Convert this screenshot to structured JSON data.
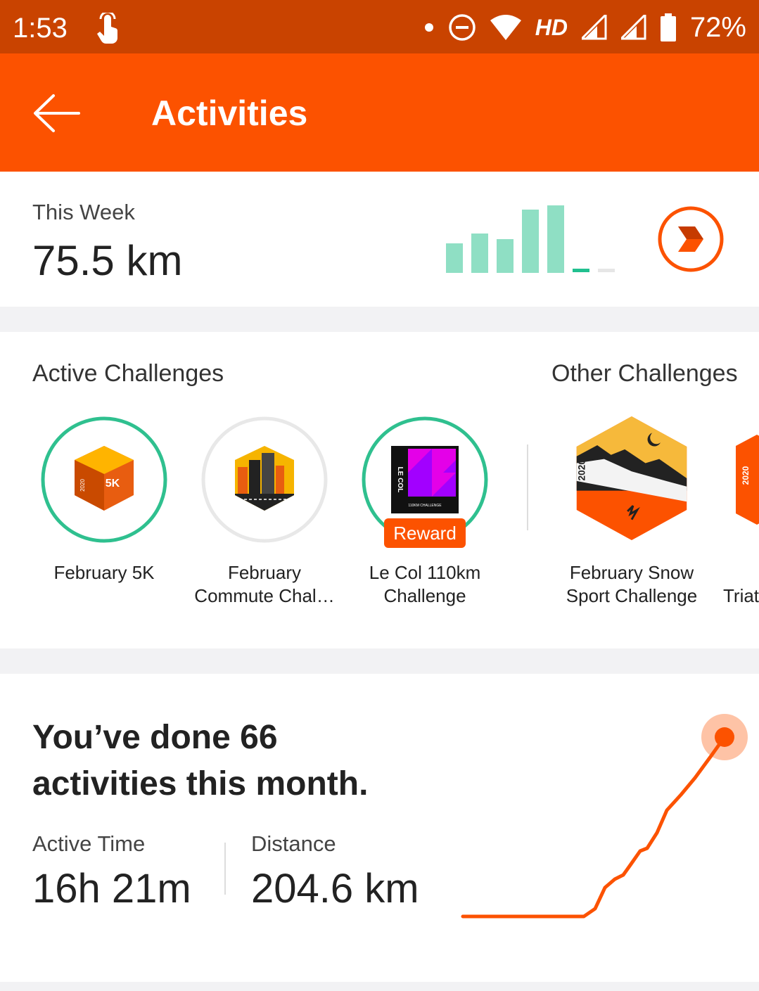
{
  "status_bar": {
    "time": "1:53",
    "battery": "72%",
    "network": "HD",
    "icons": [
      "touch-icon",
      "dot-icon",
      "do-not-disturb-icon",
      "wifi-icon",
      "signal-icon",
      "signal-icon",
      "battery-icon"
    ]
  },
  "app_bar": {
    "title": "Activities",
    "back_icon": "back-arrow-icon"
  },
  "week": {
    "label": "This Week",
    "distance": "75.5 km",
    "accent_color": "#8fdfc4",
    "arrow_icon": "chevron-right-icon"
  },
  "challenges": {
    "active_title": "Active Challenges",
    "other_title": "Other Challenges",
    "reward_label": "Reward",
    "items": [
      {
        "name_line1": "February 5K",
        "name_line2": "",
        "badge_text": "5K",
        "badge_year": "2020",
        "ring": "green"
      },
      {
        "name_line1": "February",
        "name_line2": "Commute Chal…",
        "badge_text": "",
        "badge_year": "2020",
        "ring": "grey"
      },
      {
        "name_line1": "Le Col 110km",
        "name_line2": "Challenge",
        "badge_text": "LE COL",
        "badge_subtext": "110KM CHALLENGE",
        "ring": "green"
      },
      {
        "name_line1": "February Snow",
        "name_line2": "Sport Challenge",
        "badge_year": "2020",
        "ring": "none"
      },
      {
        "name_line1": "I",
        "name_line2": "Triat",
        "badge_year": "2020",
        "ring": "none"
      }
    ]
  },
  "month": {
    "headline_line1": "You’ve done 66",
    "headline_line2": "activities this month.",
    "active_time_label": "Active Time",
    "active_time_value": "16h 21m",
    "distance_label": "Distance",
    "distance_value": "204.6 km",
    "line_color": "#fc5200"
  }
}
